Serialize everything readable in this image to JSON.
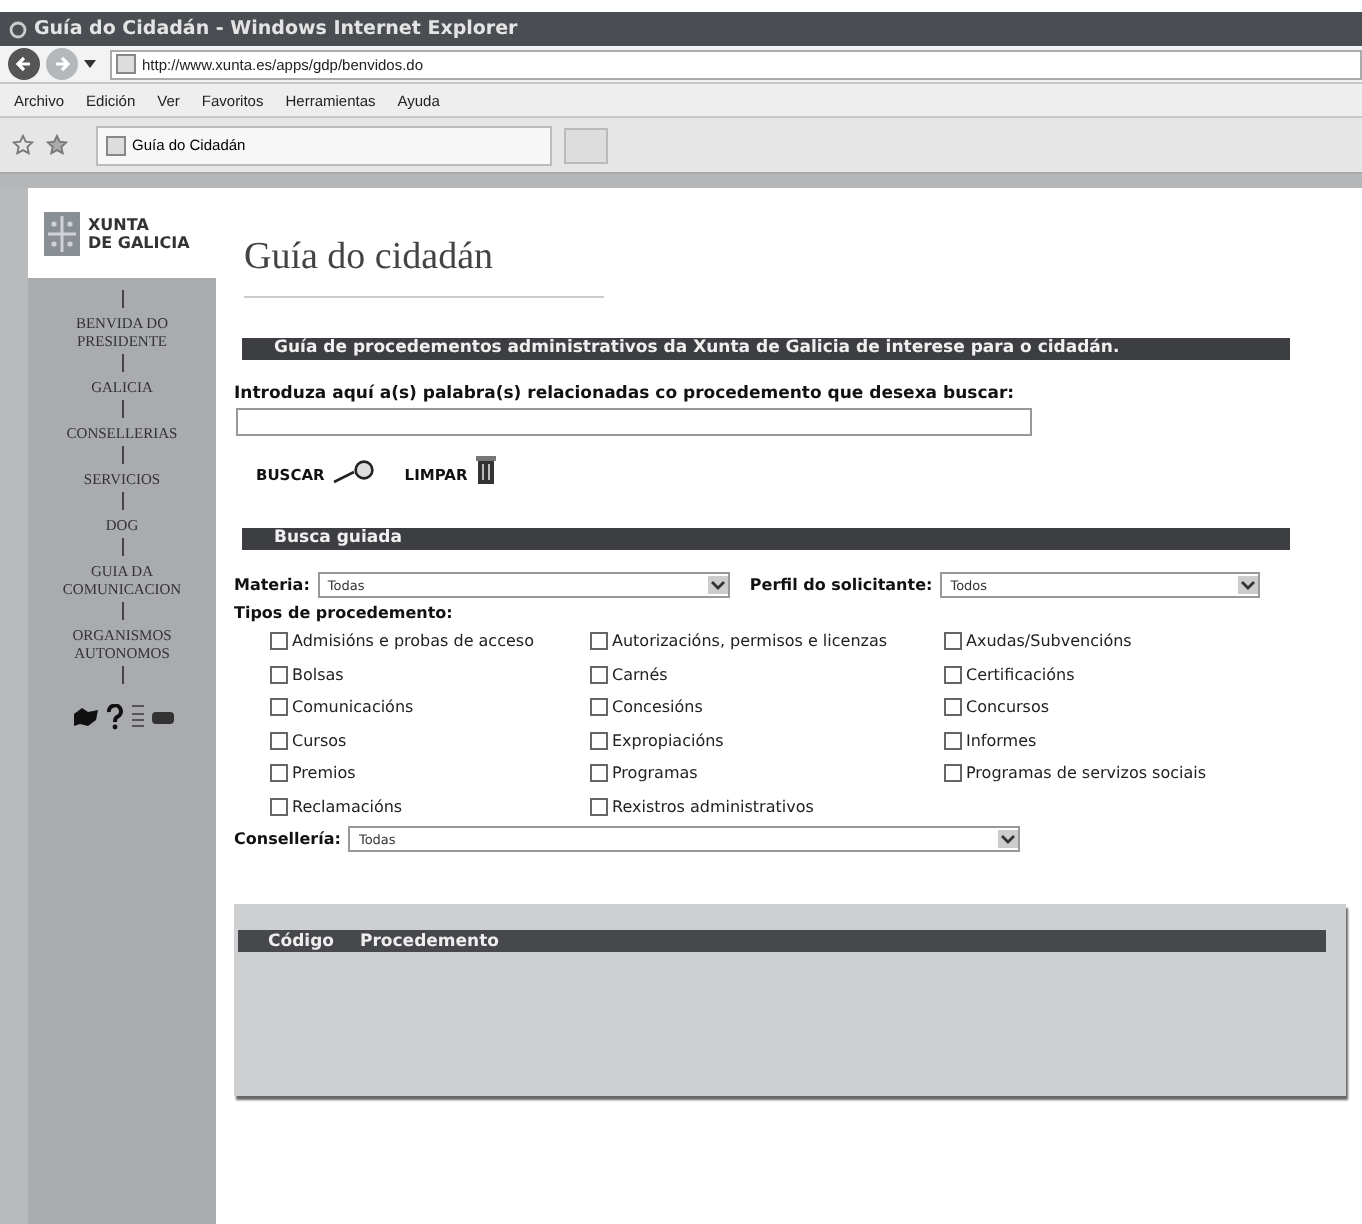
{
  "window": {
    "title": "Guía do Cidadán - Windows Internet Explorer"
  },
  "address_bar": {
    "url": "http://www.xunta.es/apps/gdp/benvidos.do"
  },
  "menu": [
    "Archivo",
    "Edición",
    "Ver",
    "Favoritos",
    "Herramientas",
    "Ayuda"
  ],
  "tabs": [
    {
      "label": "Guía do Cidadán",
      "selected": true
    }
  ],
  "sidebar": {
    "logo": {
      "line_1": "XUNTA",
      "line_2": "DE GALICIA"
    },
    "items": [
      {
        "label": "BENVIDA DO PRESIDENTE"
      },
      {
        "label": "GALICIA"
      },
      {
        "label": "CONSELLERIAS"
      },
      {
        "label": "SERVICIOS"
      },
      {
        "label": "DOG"
      },
      {
        "label": "GUIA DA COMUNICACION"
      },
      {
        "label": "ORGANISMOS AUTONOMOS"
      }
    ]
  },
  "page": {
    "title": "Guía do cidadán",
    "intro_bar": "Guía de procedementos administrativos da Xunta de Galicia de interese para o cidadán.",
    "search": {
      "label": "Introduza aquí a(s) palabra(s) relacionadas co procedemento que desexa buscar:",
      "buttons": [
        "BUSCAR",
        "LIMPAR"
      ]
    },
    "guided": {
      "heading": "Busca guiada",
      "materia": {
        "label": "Materia:",
        "value": "Todas"
      },
      "perfil": {
        "label": "Perfil do solicitante:",
        "value": "Todos"
      },
      "types_label": "Tipos de procedemento:",
      "types": [
        {
          "label": "Admisións e probas de acceso",
          "checked": false
        },
        {
          "label": "Autorizacións, permisos e licenzas",
          "checked": false
        },
        {
          "label": "Axudas/Subvencións",
          "checked": false
        },
        {
          "label": "Bolsas",
          "checked": false
        },
        {
          "label": "Carnés",
          "checked": false
        },
        {
          "label": "Certificacións",
          "checked": false
        },
        {
          "label": "Comunicacións",
          "checked": false
        },
        {
          "label": "Concesións",
          "checked": false
        },
        {
          "label": "Concursos",
          "checked": false
        },
        {
          "label": "Cursos",
          "checked": false
        },
        {
          "label": "Expropiacións",
          "checked": false
        },
        {
          "label": "Informes",
          "checked": false
        },
        {
          "label": "Premios",
          "checked": false
        },
        {
          "label": "Programas",
          "checked": false
        },
        {
          "label": "Programas de servizos sociais",
          "checked": false
        },
        {
          "label": "Reclamacións",
          "checked": false
        },
        {
          "label": "Rexistros administrativos",
          "checked": false
        }
      ],
      "conselleria": {
        "label": "Consellería:",
        "value": "Todas"
      }
    },
    "results": {
      "columns": [
        "Código",
        "Procedemento"
      ]
    }
  }
}
